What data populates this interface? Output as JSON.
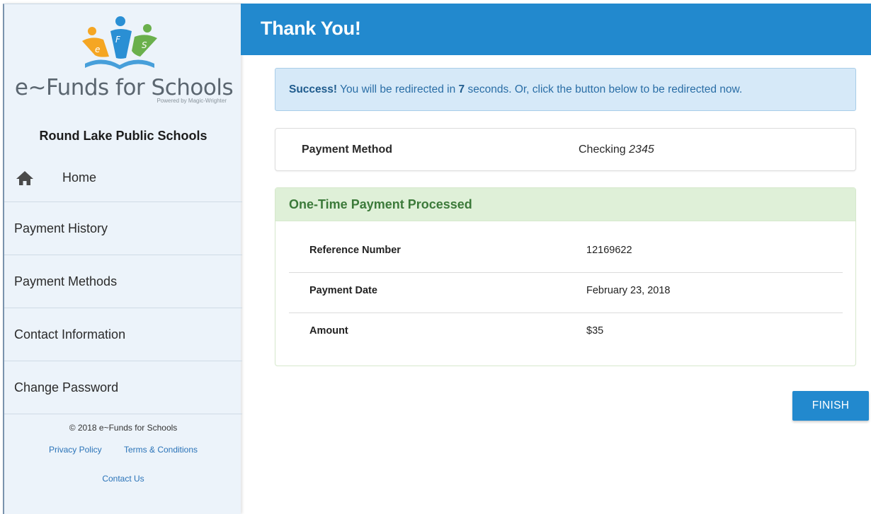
{
  "brand": {
    "logo_text": "e~Funds for Schools",
    "powered_by": "Powered by Magic-Wrighter",
    "logo_letters": [
      "e",
      "F",
      "S"
    ],
    "colors": {
      "orange": "#f5a623",
      "blue": "#2a8fd4",
      "green": "#6ab04c"
    }
  },
  "sidebar": {
    "school_name": "Round Lake Public Schools",
    "items": [
      {
        "label": "Home",
        "icon": "home-icon"
      },
      {
        "label": "Payment History"
      },
      {
        "label": "Payment Methods"
      },
      {
        "label": "Contact Information"
      },
      {
        "label": "Change Password"
      }
    ],
    "footer": {
      "copyright": "© 2018 e~Funds for Schools",
      "privacy": "Privacy Policy",
      "terms": "Terms & Conditions",
      "contact": "Contact Us"
    }
  },
  "header": {
    "title": "Thank You!",
    "color": "#2289ce"
  },
  "alert": {
    "strong": "Success!",
    "text_before": " You will be redirected in ",
    "seconds": "7",
    "text_after": " seconds. Or, click the button below to be redirected now."
  },
  "payment_method": {
    "label": "Payment Method",
    "type": "Checking",
    "last4": "2345"
  },
  "confirmation": {
    "heading": "One-Time Payment Processed",
    "rows": [
      {
        "label": "Reference Number",
        "value": "12169622"
      },
      {
        "label": "Payment Date",
        "value": "February 23, 2018"
      },
      {
        "label": "Amount",
        "value": "$35"
      }
    ]
  },
  "actions": {
    "finish_label": "FINISH"
  }
}
